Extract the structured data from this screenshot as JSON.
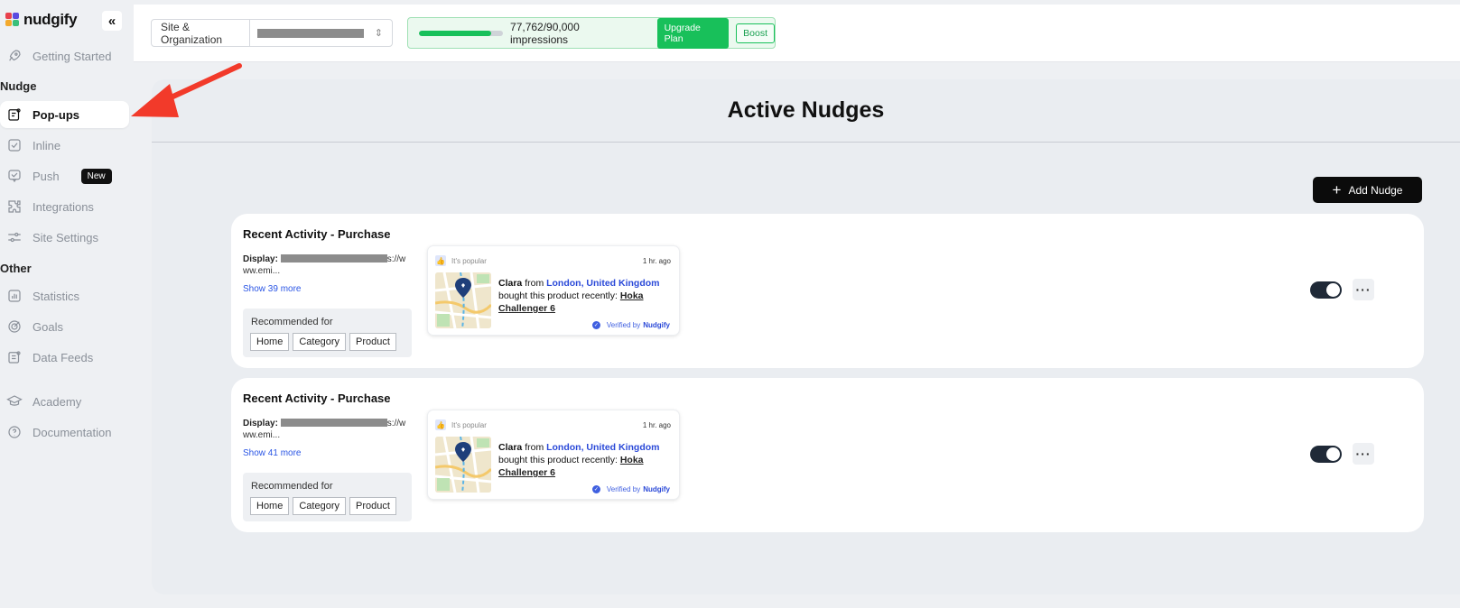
{
  "app": {
    "name": "nudgify",
    "collapse_icon": "double-chevron-left-icon",
    "brand_colors": [
      "#e8414c",
      "#5b4be0",
      "#f3a92c",
      "#3abf7a"
    ]
  },
  "sidebar": {
    "items_top": [
      {
        "label": "Getting Started",
        "icon": "rocket-icon"
      }
    ],
    "section_nudge": "Nudge",
    "nudge_items": [
      {
        "label": "Pop-ups",
        "icon": "popup-icon",
        "active": true
      },
      {
        "label": "Inline",
        "icon": "inline-icon"
      },
      {
        "label": "Push",
        "icon": "push-icon",
        "badge": "New"
      },
      {
        "label": "Integrations",
        "icon": "puzzle-icon"
      },
      {
        "label": "Site Settings",
        "icon": "sliders-icon"
      }
    ],
    "section_other": "Other",
    "other_items": [
      {
        "label": "Statistics",
        "icon": "bar-chart-icon"
      },
      {
        "label": "Goals",
        "icon": "target-icon"
      },
      {
        "label": "Data Feeds",
        "icon": "data-feed-icon"
      },
      {
        "label": "Academy",
        "icon": "graduation-cap-icon"
      },
      {
        "label": "Documentation",
        "icon": "help-circle-icon"
      }
    ]
  },
  "topbar": {
    "site_label": "Site & Organization",
    "impressions_text": "77,762/90,000 impressions",
    "impressions_used": 77762,
    "impressions_total": 90000,
    "upgrade_label": "Upgrade Plan",
    "boost_label": "Boost"
  },
  "main": {
    "title": "Active Nudges",
    "add_button": "Add Nudge",
    "nudges": [
      {
        "title": "Recent Activity - Purchase",
        "display_label": "Display:",
        "display_tail": "s://w",
        "display_line2": "ww.emi...",
        "show_more": "Show 39 more",
        "recommended_label": "Recommended for",
        "tags": [
          "Home",
          "Category",
          "Product"
        ],
        "preview": {
          "header": "It's popular",
          "time": "1 hr. ago",
          "name": "Clara",
          "from": "from",
          "location": "London, United Kingdom",
          "action": "bought this product recently:",
          "product": "Hoka Challenger 6",
          "verified_prefix": "Verified by",
          "verified_brand": "Nudgify"
        },
        "enabled": true
      },
      {
        "title": "Recent Activity - Purchase",
        "display_label": "Display:",
        "display_tail": "s://w",
        "display_line2": "ww.emi...",
        "show_more": "Show 41 more",
        "recommended_label": "Recommended for",
        "tags": [
          "Home",
          "Category",
          "Product"
        ],
        "preview": {
          "header": "It's popular",
          "time": "1 hr. ago",
          "name": "Clara",
          "from": "from",
          "location": "London, United Kingdom",
          "action": "bought this product recently:",
          "product": "Hoka Challenger 6",
          "verified_prefix": "Verified by",
          "verified_brand": "Nudgify"
        },
        "enabled": true
      }
    ]
  },
  "colors": {
    "accent_green": "#18c05a",
    "link_blue": "#2a55e5",
    "annotation_red": "#f23a2a",
    "toggle_on": "#1f2937"
  }
}
